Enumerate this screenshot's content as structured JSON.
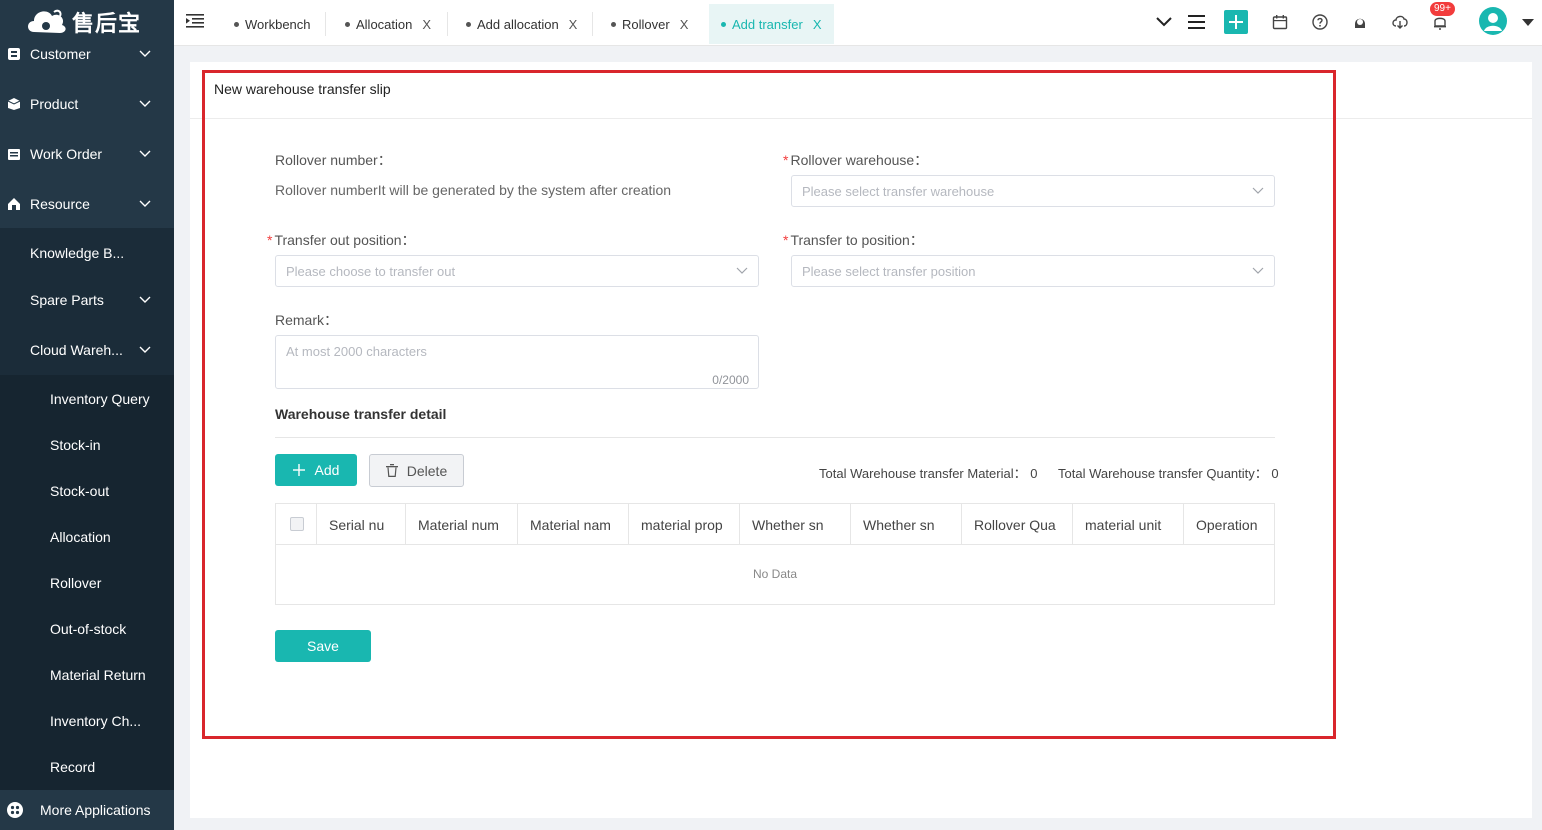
{
  "app": {
    "logo_text": "售后宝"
  },
  "sidebar": {
    "items": [
      {
        "label": "Customer",
        "icon": "customer-icon"
      },
      {
        "label": "Product",
        "icon": "product-icon"
      },
      {
        "label": "Work Order",
        "icon": "work-order-icon"
      },
      {
        "label": "Resource",
        "icon": "resource-icon"
      }
    ],
    "sub_items": [
      {
        "label": "Knowledge B..."
      },
      {
        "label": "Spare Parts"
      },
      {
        "label": "Cloud Wareh..."
      }
    ],
    "subsub_items": [
      {
        "label": "Inventory Query"
      },
      {
        "label": "Stock-in"
      },
      {
        "label": "Stock-out"
      },
      {
        "label": "Allocation"
      },
      {
        "label": "Rollover"
      },
      {
        "label": "Out-of-stock"
      },
      {
        "label": "Material Return"
      },
      {
        "label": "Inventory Ch..."
      },
      {
        "label": "Record"
      }
    ],
    "more_apps": "More Applications"
  },
  "tabs": [
    {
      "label": "Workbench"
    },
    {
      "label": "Allocation",
      "close": "X"
    },
    {
      "label": "Add allocation",
      "close": "X"
    },
    {
      "label": "Rollover",
      "close": "X"
    },
    {
      "label": "Add transfer",
      "close": "X"
    }
  ],
  "header": {
    "notification_badge": "99+"
  },
  "colors": {
    "accent": "#19b7b0",
    "sidebar": "#243847",
    "frame": "#d9262c",
    "badge": "#f23c3c"
  },
  "form": {
    "title": "New warehouse transfer slip",
    "rollover_number_label": "Rollover number：",
    "rollover_number_value": "Rollover numberIt will be generated by the system after creation",
    "rollover_warehouse_label": "Rollover warehouse：",
    "rollover_warehouse_placeholder": "Please select transfer warehouse",
    "transfer_out_label": "Transfer out position：",
    "transfer_out_placeholder": "Please choose to transfer out",
    "transfer_to_label": "Transfer to position：",
    "transfer_to_placeholder": "Please select transfer position",
    "remark_label": "Remark：",
    "remark_placeholder": "At most 2000 characters",
    "remark_count": "0/2000",
    "required_mark": "*"
  },
  "detail": {
    "title": "Warehouse transfer detail",
    "add_label": "Add",
    "delete_label": "Delete",
    "total_material": "Total Warehouse transfer Material：  0",
    "total_quantity": "Total Warehouse transfer Quantity：  0",
    "columns": [
      "Serial nu",
      "Material num",
      "Material nam",
      "material prop",
      "Whether sn",
      "Whether sn",
      "Rollover Qua",
      "material unit",
      "Operation"
    ],
    "empty_text": "No Data"
  },
  "save_label": "Save"
}
